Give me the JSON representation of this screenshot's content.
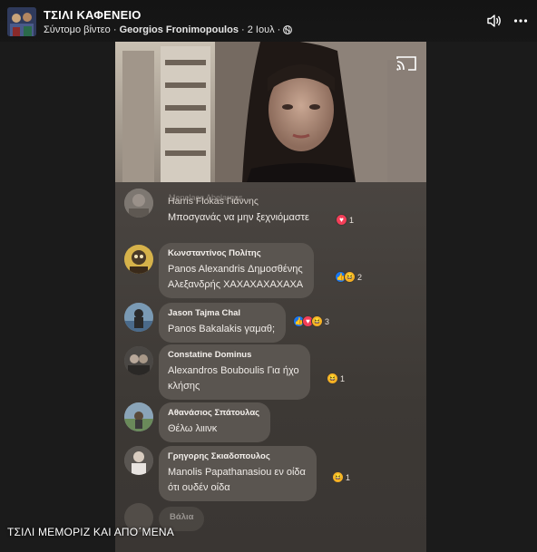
{
  "header": {
    "page_name": "ΤΣΙΛΙ ΚΑΦΕΝΕΙΟ",
    "video_type": "Σύντομο βίντεο",
    "separator": " · ",
    "author": "Georgios Fronimopoulos",
    "date": "2 Ιουλ",
    "audience_icon": "globe-icon",
    "volume_icon": "volume-icon",
    "more_icon": "more-options-icon"
  },
  "video": {
    "cast_icon": "cast-icon",
    "ghost_comment": "Menelaos Abelargas",
    "comments": [
      {
        "author": "Harris Flokas Γιάννης",
        "lines": [
          "Μποσγανάς να μην ξεχνιόμαστε"
        ],
        "reactions": [
          "love"
        ],
        "count": "1"
      },
      {
        "author": "Κωνσταντίνος Πολίτης",
        "lines": [
          "Panos Alexandris Δημοσθένης",
          "Αλεξανδρής ΧΑΧΑΧΑΧΑΧΑΧΑ"
        ],
        "reactions": [
          "like",
          "haha"
        ],
        "count": "2"
      },
      {
        "author": "Jason Tajma Chal",
        "lines": [
          "Panos Bakalakis γαμαθ;"
        ],
        "reactions": [
          "like",
          "love",
          "haha"
        ],
        "count": "3"
      },
      {
        "author": "Constatine Dominus",
        "lines": [
          "Alexandros Bouboulis Για ήχο",
          "κλήσης"
        ],
        "reactions": [
          "haha"
        ],
        "count": "1"
      },
      {
        "author": "Αθανάσιος Σπάτουλας",
        "lines": [
          "Θέλω λιιινκ"
        ],
        "reactions": [],
        "count": ""
      },
      {
        "author": "Γρηγορης Σκιαδοπουλος",
        "lines": [
          "Manolis Papathanasiou εν οίδα",
          "ότι ουδέν οίδα"
        ],
        "reactions": [
          "haha"
        ],
        "count": "1"
      }
    ],
    "partial_comment": "Βάλια"
  },
  "caption": "ΤΣΙΛΙ ΜΕΜΟΡΙΖ ΚΑΙ ΑΠΟ΄ΜΕΝΑ",
  "colors": {
    "background": "#1b1b1b",
    "bubble": "#5a5550",
    "like": "#1877f2",
    "love": "#f33e58",
    "haha": "#f7b125"
  }
}
